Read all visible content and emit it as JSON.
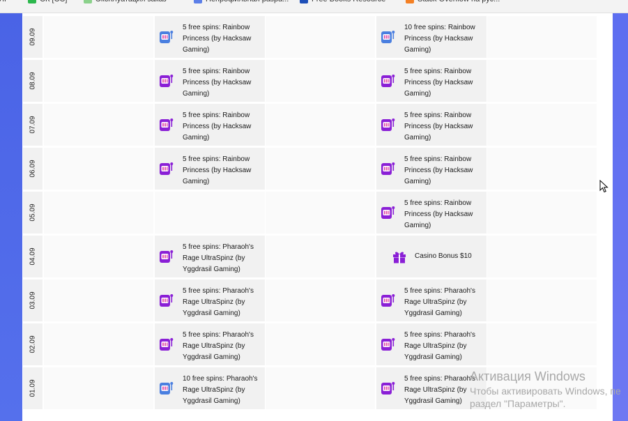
{
  "bookmarks": [
    {
      "label": "ЙІ",
      "color": "#ffffff"
    },
    {
      "label": "СК [СС]",
      "color": "#2db84d"
    },
    {
      "label": "Эксплуатация заказ",
      "color": "#8bd18b"
    },
    {
      "label": "Непрофильная разра...",
      "color": "#5c7fe8"
    },
    {
      "label": "Free Books Resource",
      "color": "#1e4fb8"
    },
    {
      "label": "Stack Overflow на рус...",
      "color": "#f48024"
    }
  ],
  "rows": [
    {
      "date": "09.09",
      "col1": {
        "icon": "slot-machine-blue-icon",
        "text": "5 free spins: Rainbow Princess (by Hacksaw Gaming)"
      },
      "col2": {
        "icon": "slot-machine-blue-icon",
        "text": "10 free spins: Rainbow Princess (by Hacksaw Gaming)"
      }
    },
    {
      "date": "08.09",
      "col1": {
        "icon": "slot-machine-purple-icon",
        "text": "5 free spins: Rainbow Princess (by Hacksaw Gaming)"
      },
      "col2": {
        "icon": "slot-machine-purple-icon",
        "text": "5 free spins: Rainbow Princess (by Hacksaw Gaming)"
      }
    },
    {
      "date": "07.09",
      "col1": {
        "icon": "slot-machine-purple-icon",
        "text": "5 free spins: Rainbow Princess (by Hacksaw Gaming)"
      },
      "col2": {
        "icon": "slot-machine-purple-icon",
        "text": "5 free spins: Rainbow Princess (by Hacksaw Gaming)"
      }
    },
    {
      "date": "06.09",
      "col1": {
        "icon": "slot-machine-purple-icon",
        "text": "5 free spins: Rainbow Princess (by Hacksaw Gaming)"
      },
      "col2": {
        "icon": "slot-machine-purple-icon",
        "text": "5 free spins: Rainbow Princess (by Hacksaw Gaming)"
      }
    },
    {
      "date": "05.09",
      "col1": null,
      "col2": {
        "icon": "slot-machine-purple-icon",
        "text": "5 free spins: Rainbow Princess (by Hacksaw Gaming)"
      }
    },
    {
      "date": "04.09",
      "col1": {
        "icon": "slot-machine-purple-icon",
        "text": "5 free spins: Pharaoh's Rage UltraSpinz (by Yggdrasil Gaming)"
      },
      "col2": {
        "icon": "gift-icon",
        "text": "Casino Bonus $10"
      }
    },
    {
      "date": "03.09",
      "col1": {
        "icon": "slot-machine-purple-icon",
        "text": "5 free spins: Pharaoh's Rage UltraSpinz (by Yggdrasil Gaming)"
      },
      "col2": {
        "icon": "slot-machine-purple-icon",
        "text": "5 free spins: Pharaoh's Rage UltraSpinz (by Yggdrasil Gaming)"
      }
    },
    {
      "date": "02.09",
      "col1": {
        "icon": "slot-machine-purple-icon",
        "text": "5 free spins: Pharaoh's Rage UltraSpinz (by Yggdrasil Gaming)"
      },
      "col2": {
        "icon": "slot-machine-purple-icon",
        "text": "5 free spins: Pharaoh's Rage UltraSpinz (by Yggdrasil Gaming)"
      }
    },
    {
      "date": "01.09",
      "col1": {
        "icon": "slot-machine-blue-icon",
        "text": "10 free spins: Pharaoh's Rage UltraSpinz (by Yggdrasil Gaming)"
      },
      "col2": {
        "icon": "slot-machine-purple-icon",
        "text": "5 free spins: Pharaoh's Rage UltraSpinz (by Yggdrasil Gaming)"
      }
    }
  ],
  "colors": {
    "purple": "#8a1fd6",
    "blue": "#4a7fe0",
    "pink": "#e45bb0"
  },
  "watermark": {
    "line1": "Активация Windows",
    "line2": "Чтобы активировать Windows, пе",
    "line3": "раздел \"Параметры\"."
  }
}
